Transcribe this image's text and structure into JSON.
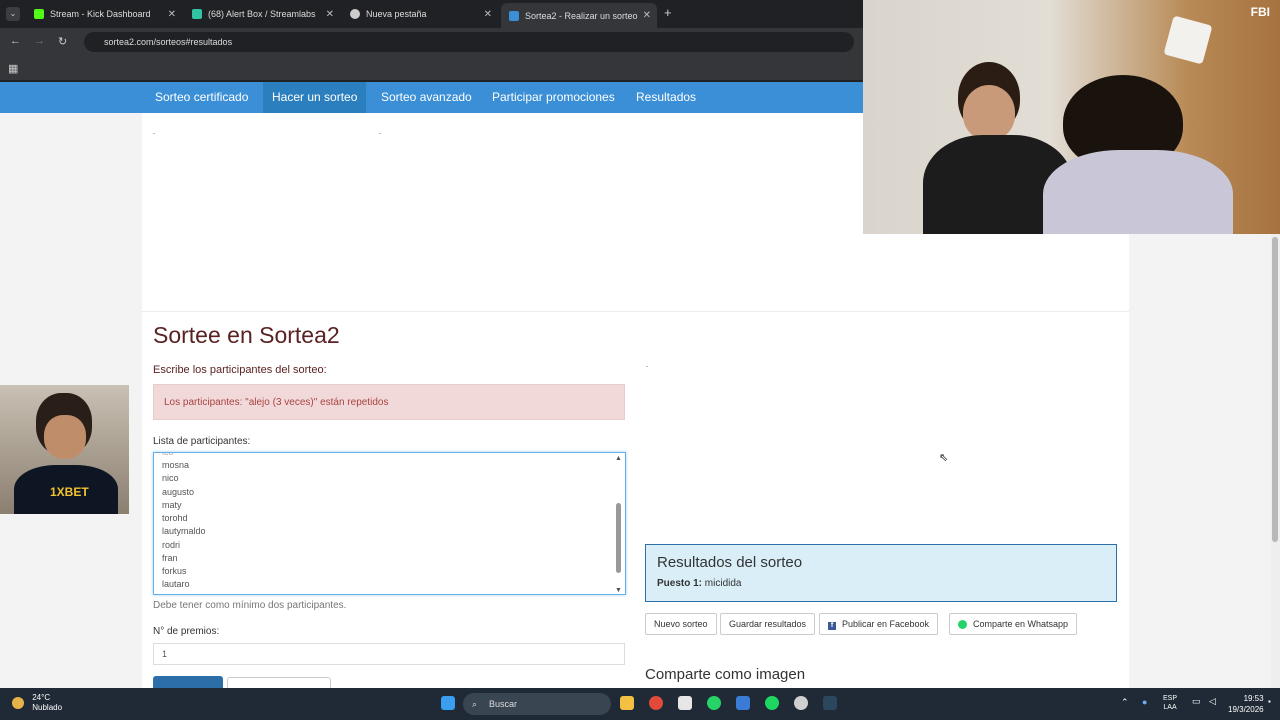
{
  "browser": {
    "tabs": [
      {
        "label": "Stream - Kick Dashboard",
        "favicon_color": "#53fc18"
      },
      {
        "label": "(68) Alert Box / Streamlabs",
        "favicon_color": "#31c3a2"
      },
      {
        "label": "Nueva pestaña",
        "favicon_color": "#cccccc"
      },
      {
        "label": "Sortea2 - Realizar un sorteo",
        "favicon_color": "#3a8fd6"
      }
    ],
    "url": "sortea2.com/sorteos#resultados"
  },
  "site_nav": {
    "items": [
      "Sorteo certificado",
      "Hacer un sorteo",
      "Sorteo avanzado",
      "Participar promociones",
      "Resultados"
    ],
    "active": "Hacer un sorteo"
  },
  "form": {
    "title": "Sortee en Sortea2",
    "participants_heading": "Escribe los participantes del sorteo:",
    "alert": "Los participantes: \"alejo (3 veces)\" están repetidos",
    "list_label": "Lista de participantes:",
    "participants": [
      "mosna",
      "nico",
      "augusto",
      "maty",
      "torohd",
      "lautymaldo",
      "rodri",
      "fran",
      "forkus",
      "lautaro"
    ],
    "help": "Debe tener como mínimo dos participantes.",
    "prizes_label": "N° de premios:",
    "prizes_value": "1"
  },
  "results": {
    "title": "Resultados del sorteo",
    "place_label": "Puesto 1:",
    "winner": "micidida"
  },
  "actions": {
    "new": "Nuevo sorteo",
    "save": "Guardar resultados",
    "facebook": "Publicar en Facebook",
    "whatsapp": "Comparte en Whatsapp"
  },
  "share_title": "Comparte como imagen",
  "webcam_overlay": "FBI",
  "webcam_logo": "1XBET",
  "taskbar": {
    "temp": "24°C",
    "weather": "Nublado",
    "search": "Buscar",
    "lang": "ESP",
    "lang2": "LAA",
    "time": "19:53",
    "date": "19/3/2026"
  }
}
